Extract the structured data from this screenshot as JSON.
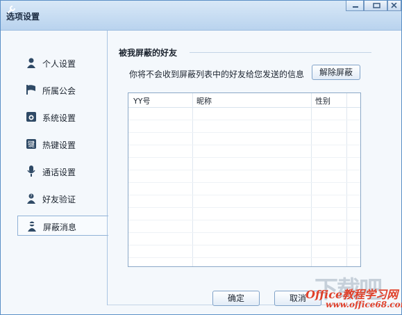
{
  "window": {
    "title": "选项设置"
  },
  "sidebar": {
    "items": [
      {
        "label": "个人设置",
        "icon": "person-icon"
      },
      {
        "label": "所属公会",
        "icon": "flag-icon"
      },
      {
        "label": "系统设置",
        "icon": "system-icon"
      },
      {
        "label": "热键设置",
        "icon": "key-icon"
      },
      {
        "label": "通话设置",
        "icon": "microphone-icon"
      },
      {
        "label": "好友验证",
        "icon": "verify-icon"
      },
      {
        "label": "屏蔽消息",
        "icon": "block-icon",
        "selected": true
      }
    ]
  },
  "main": {
    "section_title": "被我屏蔽的好友",
    "description": "你将不会收到屏蔽列表中的好友给您发送的信息",
    "unblock_button": "解除屏蔽",
    "table": {
      "columns": [
        "YY号",
        "昵称",
        "性别"
      ],
      "rows": []
    }
  },
  "footer": {
    "ok_label": "确定",
    "cancel_label": "取消"
  },
  "watermark": {
    "line1": "下载吧",
    "line2": "Office教程学习网",
    "line3": "www.office68.com"
  },
  "colors": {
    "accent": "#5a8fc6",
    "selected_bg": "#f8fbfe",
    "watermark_red": "#e0402a"
  }
}
